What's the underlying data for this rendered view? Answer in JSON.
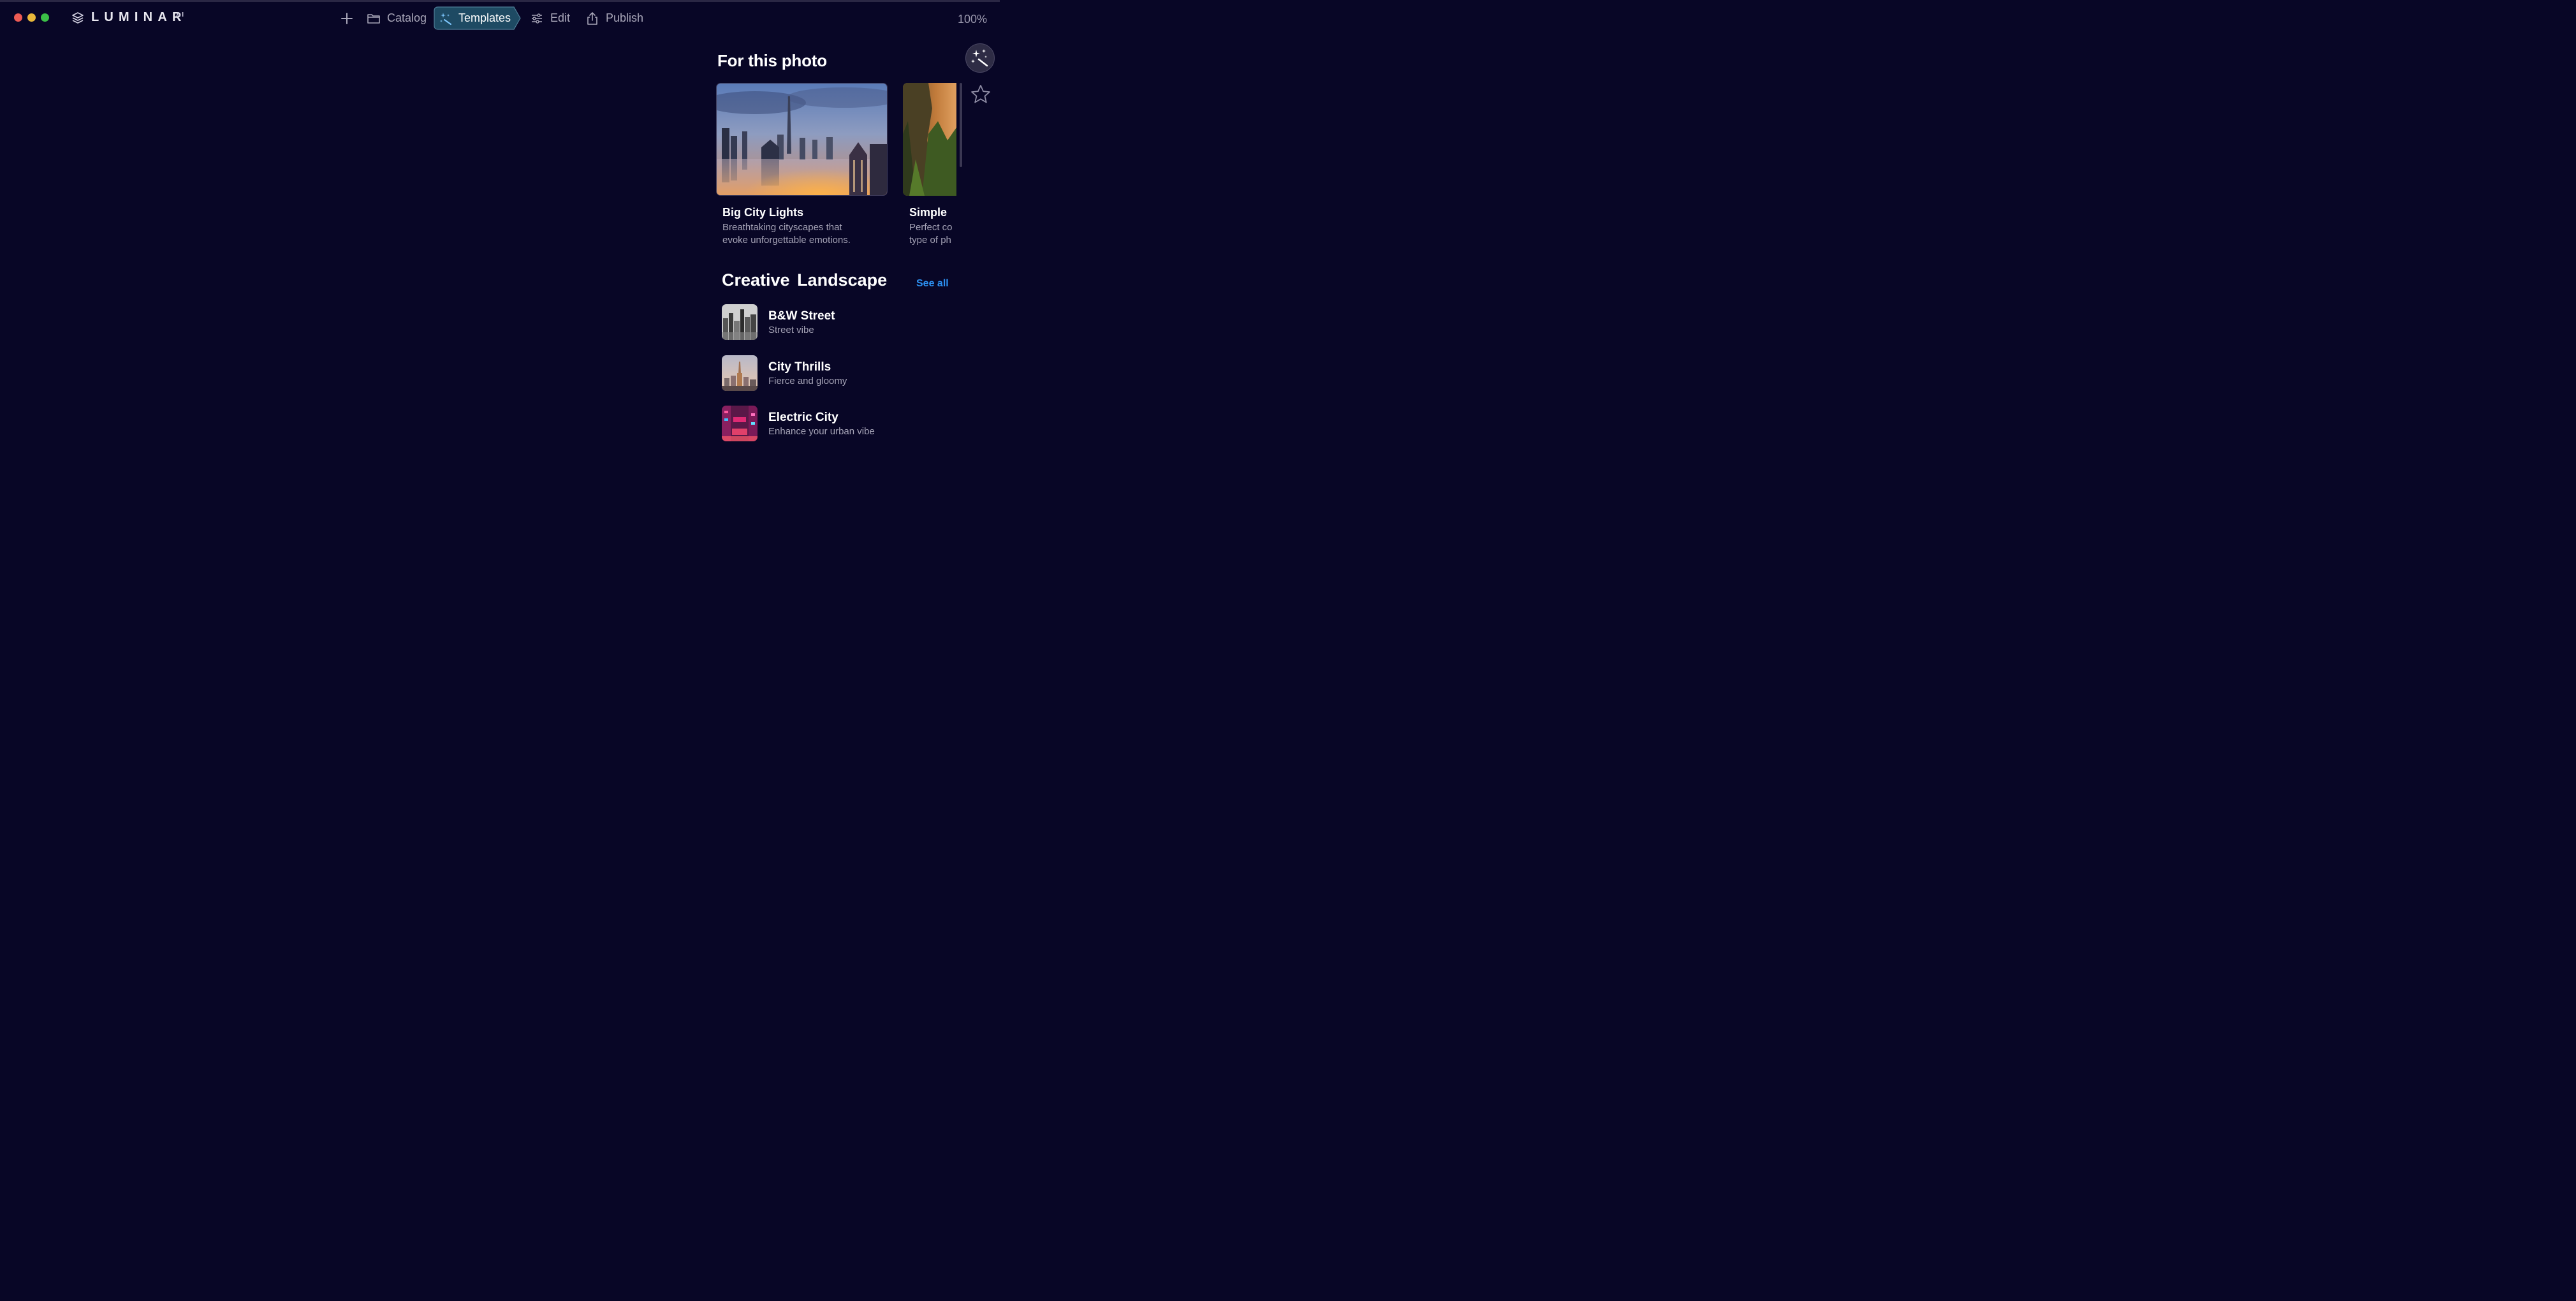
{
  "app": {
    "logo_text": "LUMINAR",
    "logo_suffix": "AI",
    "zoom": "100%"
  },
  "nav": {
    "catalog": "Catalog",
    "templates": "Templates",
    "edit": "Edit",
    "publish": "Publish"
  },
  "panel": {
    "for_this_photo": "For this photo",
    "cards": [
      {
        "title": "Big City Lights",
        "desc_line1": "Breathtaking cityscapes that",
        "desc_line2": "evoke unforgettable emotions."
      },
      {
        "title": "Simple",
        "desc_line1": "Perfect co",
        "desc_line2": "type of ph"
      }
    ],
    "section_title": "Creative Landscape",
    "see_all": "See all",
    "items": [
      {
        "title": "B&W Street",
        "subtitle": "Street vibe"
      },
      {
        "title": "City Thrills",
        "subtitle": "Fierce and gloomy"
      },
      {
        "title": "Electric City",
        "subtitle": "Enhance your urban vibe"
      }
    ]
  },
  "icons": {
    "logo": "layers-icon",
    "add": "plus-icon",
    "catalog": "folder-icon",
    "templates": "magic-wand-icon",
    "edit": "sliders-icon",
    "publish": "share-icon",
    "ai_tool": "magic-wand-icon",
    "favorites": "star-icon"
  },
  "colors": {
    "background": "#080626",
    "accent_link": "#2c8ff0",
    "active_tab": "#1e4a63"
  }
}
